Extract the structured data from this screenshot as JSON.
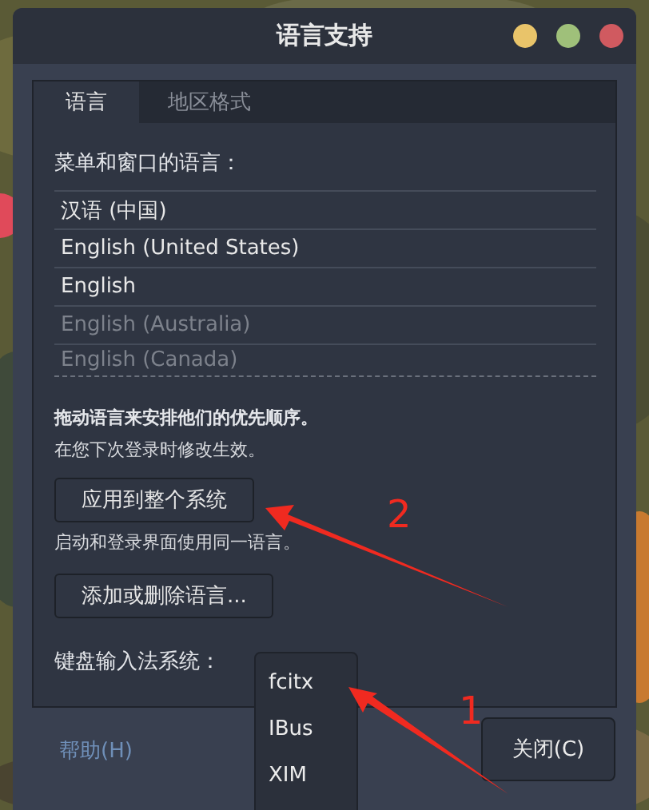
{
  "window": {
    "title": "语言支持"
  },
  "tabs": [
    {
      "label": "语言",
      "selected": true
    },
    {
      "label": "地区格式",
      "selected": false
    }
  ],
  "languages_label": "菜单和窗口的语言：",
  "languages": [
    {
      "name": "汉语 (中国)",
      "dimmed": false
    },
    {
      "name": "English (United States)",
      "dimmed": false
    },
    {
      "name": "English",
      "dimmed": false
    },
    {
      "name": "English (Australia)",
      "dimmed": true
    },
    {
      "name": "English (Canada)",
      "dimmed": true
    }
  ],
  "drag_hint": "拖动语言来安排他们的优先顺序。",
  "login_hint": "在您下次登录时修改生效。",
  "apply_button": "应用到整个系统",
  "apply_hint": "启动和登录界面使用同一语言。",
  "add_remove_button": "添加或删除语言...",
  "input_method": {
    "label": "键盘输入法系统：",
    "options": [
      "fcitx",
      "IBus",
      "XIM"
    ]
  },
  "help_button": "帮助(H)",
  "close_button": "关闭(C)",
  "annotations": [
    {
      "label": "2"
    },
    {
      "label": "1"
    }
  ]
}
